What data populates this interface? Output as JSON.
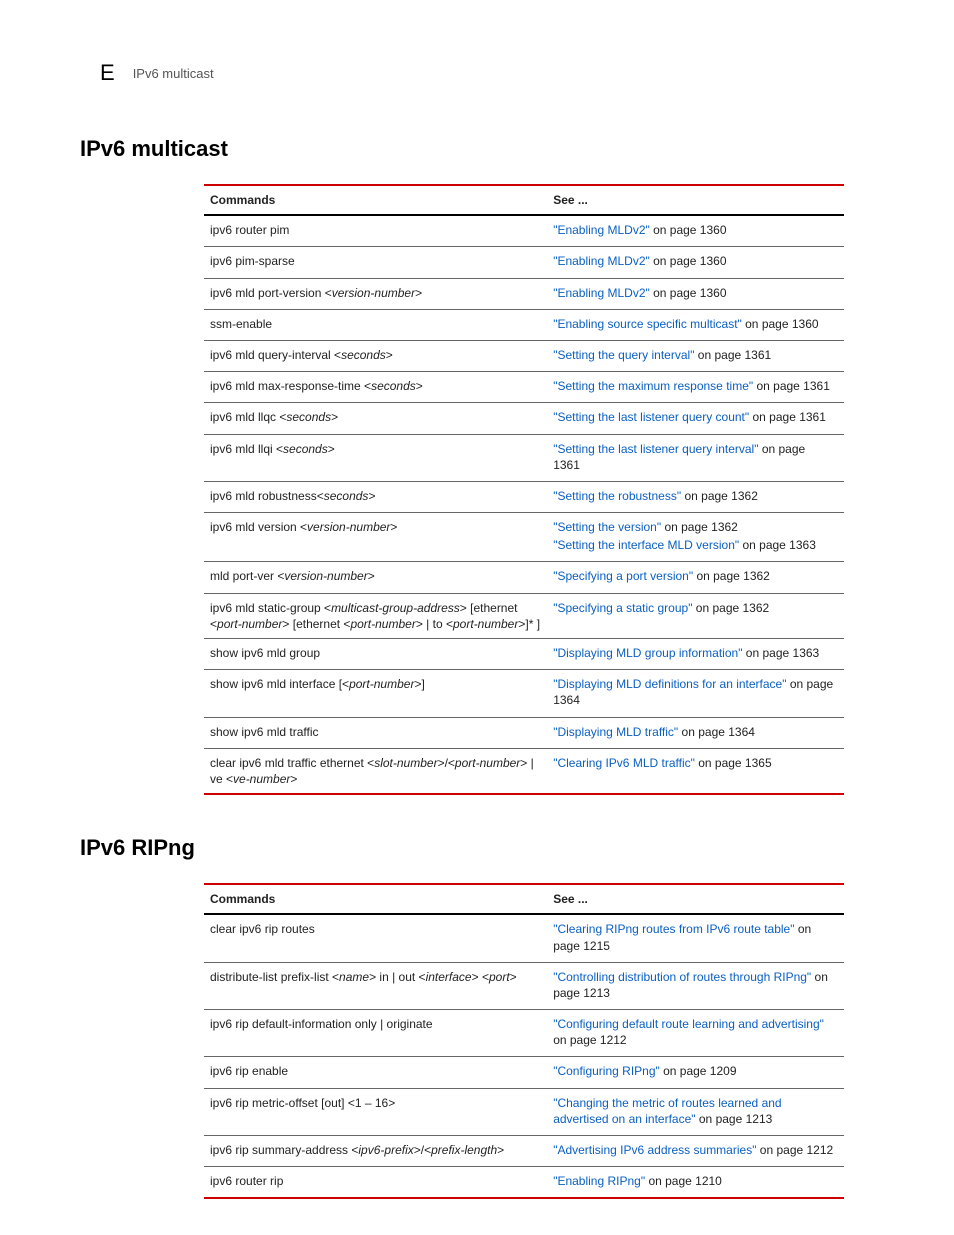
{
  "header": {
    "appendix_letter": "E",
    "header_title": "IPv6 multicast"
  },
  "sections": [
    {
      "title": "IPv6 multicast",
      "table_headers": {
        "commands": "Commands",
        "see": "See ..."
      },
      "rows": [
        {
          "cmd_parts": [
            {
              "t": "ipv6 router pim"
            }
          ],
          "see": [
            {
              "link": "\"Enabling MLDv2\"",
              "suffix": " on page 1360"
            }
          ]
        },
        {
          "cmd_parts": [
            {
              "t": "ipv6 pim-sparse"
            }
          ],
          "see": [
            {
              "link": "\"Enabling MLDv2\"",
              "suffix": " on page 1360"
            }
          ]
        },
        {
          "cmd_parts": [
            {
              "t": "ipv6 mld port-version <"
            },
            {
              "t": "version-number",
              "i": true
            },
            {
              "t": ">"
            }
          ],
          "see": [
            {
              "link": "\"Enabling MLDv2\"",
              "suffix": " on page 1360"
            }
          ]
        },
        {
          "cmd_parts": [
            {
              "t": "ssm-enable"
            }
          ],
          "see": [
            {
              "link": "\"Enabling source specific multicast\"",
              "suffix": " on page 1360"
            }
          ]
        },
        {
          "cmd_parts": [
            {
              "t": "ipv6 mld query-interval <"
            },
            {
              "t": "seconds",
              "i": true
            },
            {
              "t": ">"
            }
          ],
          "see": [
            {
              "link": "\"Setting the query interval\"",
              "suffix": " on page 1361"
            }
          ]
        },
        {
          "cmd_parts": [
            {
              "t": "ipv6 mld max-response-time <"
            },
            {
              "t": "seconds",
              "i": true
            },
            {
              "t": ">"
            }
          ],
          "see": [
            {
              "link": "\"Setting the maximum response time\"",
              "suffix": " on page 1361"
            }
          ]
        },
        {
          "cmd_parts": [
            {
              "t": "ipv6 mld llqc <"
            },
            {
              "t": "seconds",
              "i": true
            },
            {
              "t": ">"
            }
          ],
          "see": [
            {
              "link": "\"Setting the last listener query count\"",
              "suffix": " on page 1361"
            }
          ]
        },
        {
          "cmd_parts": [
            {
              "t": "ipv6 mld llqi <"
            },
            {
              "t": "seconds",
              "i": true
            },
            {
              "t": ">"
            }
          ],
          "see": [
            {
              "link": "\"Setting the last listener query interval\"",
              "suffix": " on page 1361"
            }
          ]
        },
        {
          "cmd_parts": [
            {
              "t": "ipv6 mld robustness<"
            },
            {
              "t": "seconds",
              "i": true
            },
            {
              "t": ">"
            }
          ],
          "see": [
            {
              "link": "\"Setting the robustness\"",
              "suffix": " on page 1362"
            }
          ]
        },
        {
          "cmd_parts": [
            {
              "t": "ipv6 mld version <"
            },
            {
              "t": "version-number",
              "i": true
            },
            {
              "t": ">"
            }
          ],
          "see": [
            {
              "link": "\"Setting the version\"",
              "suffix": " on page 1362"
            },
            {
              "link": "\"Setting the interface MLD version\"",
              "suffix": " on page 1363"
            }
          ]
        },
        {
          "cmd_parts": [
            {
              "t": "mld port-ver <"
            },
            {
              "t": "version-number",
              "i": true
            },
            {
              "t": ">"
            }
          ],
          "see": [
            {
              "link": "\"Specifying a port version\"",
              "suffix": " on page 1362"
            }
          ]
        },
        {
          "cmd_parts": [
            {
              "t": "ipv6 mld static-group <"
            },
            {
              "t": "multicast-group-address",
              "i": true
            },
            {
              "t": "> [ethernet <"
            },
            {
              "t": "port-number",
              "i": true
            },
            {
              "t": "> [ethernet <"
            },
            {
              "t": "port-number",
              "i": true
            },
            {
              "t": "> | to <"
            },
            {
              "t": "port-number",
              "i": true
            },
            {
              "t": ">]* ]"
            }
          ],
          "see": [
            {
              "link": "\"Specifying a static group\"",
              "suffix": " on page 1362"
            }
          ]
        },
        {
          "cmd_parts": [
            {
              "t": "show ipv6 mld group"
            }
          ],
          "see": [
            {
              "link": "\"Displaying MLD group information\"",
              "suffix": " on page 1363"
            }
          ]
        },
        {
          "cmd_parts": [
            {
              "t": "show ipv6 mld interface [<"
            },
            {
              "t": "port-number",
              "i": true
            },
            {
              "t": ">]"
            }
          ],
          "see": [
            {
              "link": "\"Displaying MLD definitions for an interface\"",
              "suffix": " on page 1364"
            }
          ]
        },
        {
          "cmd_parts": [
            {
              "t": "show ipv6 mld traffic"
            }
          ],
          "see": [
            {
              "link": "\"Displaying MLD traffic\"",
              "suffix": " on page 1364"
            }
          ]
        },
        {
          "cmd_parts": [
            {
              "t": "clear ipv6 mld traffic ethernet <"
            },
            {
              "t": "slot-number",
              "i": true
            },
            {
              "t": ">/<"
            },
            {
              "t": "port-number",
              "i": true
            },
            {
              "t": "> | ve <"
            },
            {
              "t": "ve-number",
              "i": true
            },
            {
              "t": ">"
            }
          ],
          "see": [
            {
              "link": "\"Clearing IPv6 MLD traffic\"",
              "suffix": " on page 1365"
            }
          ]
        }
      ]
    },
    {
      "title": "IPv6 RIPng",
      "table_headers": {
        "commands": "Commands",
        "see": "See ..."
      },
      "rows": [
        {
          "cmd_parts": [
            {
              "t": "clear ipv6 rip routes"
            }
          ],
          "see": [
            {
              "link": "\"Clearing RIPng routes from IPv6 route table\"",
              "suffix": " on page 1215"
            }
          ]
        },
        {
          "cmd_parts": [
            {
              "t": "distribute-list prefix-list <"
            },
            {
              "t": "name",
              "i": true
            },
            {
              "t": "> in | out <"
            },
            {
              "t": "interface",
              "i": true
            },
            {
              "t": "> <"
            },
            {
              "t": "port",
              "i": true
            },
            {
              "t": ">"
            }
          ],
          "see": [
            {
              "link": "\"Controlling distribution of routes through RIPng\"",
              "suffix": " on page 1213"
            }
          ]
        },
        {
          "cmd_parts": [
            {
              "t": "ipv6 rip default-information only | originate"
            }
          ],
          "see": [
            {
              "link": "\"Configuring default route learning and advertising\"",
              "suffix": " on page 1212"
            }
          ]
        },
        {
          "cmd_parts": [
            {
              "t": "ipv6 rip enable"
            }
          ],
          "see": [
            {
              "link": "\"Configuring RIPng\"",
              "suffix": " on page 1209"
            }
          ]
        },
        {
          "cmd_parts": [
            {
              "t": "ipv6 rip metric-offset [out] <1 – 16>"
            }
          ],
          "see": [
            {
              "link": "\"Changing the metric of routes learned and advertised on an interface\"",
              "suffix": " on page 1213"
            }
          ]
        },
        {
          "cmd_parts": [
            {
              "t": "ipv6 rip summary-address <"
            },
            {
              "t": "ipv6-prefix",
              "i": true
            },
            {
              "t": ">/<"
            },
            {
              "t": "prefix-length",
              "i": true
            },
            {
              "t": ">"
            }
          ],
          "see": [
            {
              "link": "\"Advertising IPv6 address summaries\"",
              "suffix": " on page 1212"
            }
          ]
        },
        {
          "cmd_parts": [
            {
              "t": "ipv6 router rip"
            }
          ],
          "see": [
            {
              "link": "\"Enabling RIPng\"",
              "suffix": " on page 1210"
            }
          ]
        }
      ]
    }
  ]
}
